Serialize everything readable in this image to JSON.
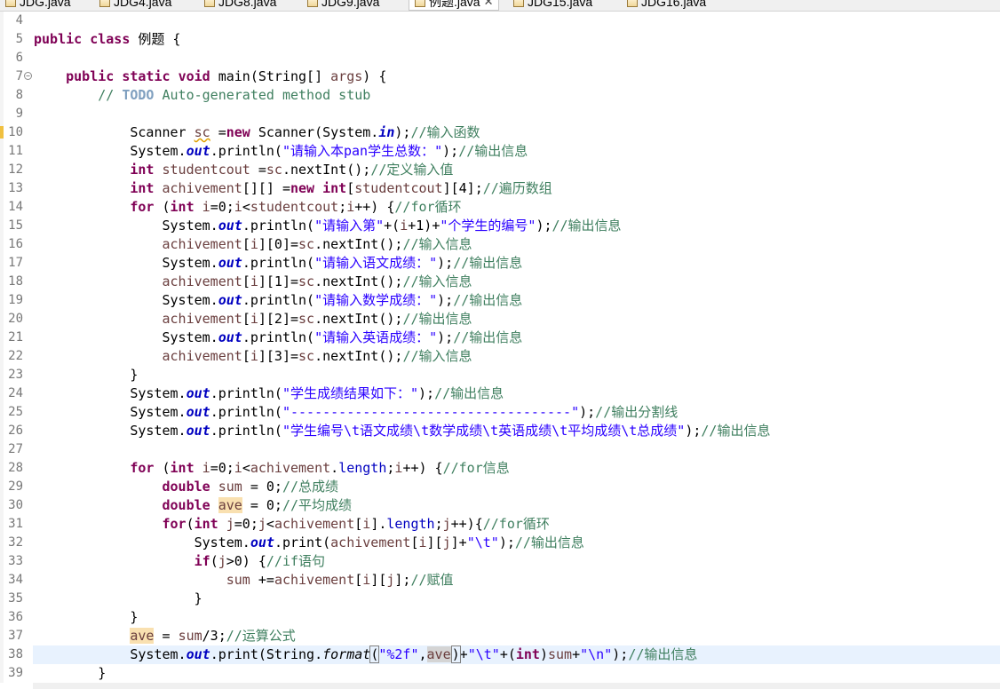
{
  "tabs": [
    {
      "label": "JDG.java",
      "active": false
    },
    {
      "label": "JDG4.java",
      "active": false
    },
    {
      "label": "JDG8.java",
      "active": false
    },
    {
      "label": "JDG9.java",
      "active": false
    },
    {
      "label": "例题.java",
      "active": true
    },
    {
      "label": "JDG15.java",
      "active": false
    },
    {
      "label": "JDG16.java",
      "active": false
    }
  ],
  "colors": {
    "keyword": "#7f0055",
    "comment": "#3f7f5f",
    "string": "#2a00ff",
    "field": "#0000c0",
    "local_var": "#6a3e3e",
    "current_line": "#e8f2fe"
  },
  "editor": {
    "current_line": 38,
    "lines": [
      {
        "n": "4",
        "text": ""
      },
      {
        "n": "5",
        "text": "public class 例题 {"
      },
      {
        "n": "6",
        "text": ""
      },
      {
        "n": "7",
        "text": "    public static void main(String[] args) {"
      },
      {
        "n": "8",
        "text": "        // TODO Auto-generated method stub"
      },
      {
        "n": "9",
        "text": ""
      },
      {
        "n": "10",
        "text": "            Scanner sc =new Scanner(System.in);//输入函数"
      },
      {
        "n": "11",
        "text": "            System.out.println(\"请输入本pan学生总数：\");//输出信息"
      },
      {
        "n": "12",
        "text": "            int studentcout =sc.nextInt();//定义输入值"
      },
      {
        "n": "13",
        "text": "            int achivement[][] =new int[studentcout][4];//遍历数组"
      },
      {
        "n": "14",
        "text": "            for (int i=0;i<studentcout;i++) {//for循环"
      },
      {
        "n": "15",
        "text": "                System.out.println(\"请输入第\"+(i+1)+\"个学生的编号\");//输出信息"
      },
      {
        "n": "16",
        "text": "                achivement[i][0]=sc.nextInt();//输入信息"
      },
      {
        "n": "17",
        "text": "                System.out.println(\"请输入语文成绩：\");//输出信息"
      },
      {
        "n": "18",
        "text": "                achivement[i][1]=sc.nextInt();//输入信息"
      },
      {
        "n": "19",
        "text": "                System.out.println(\"请输入数学成绩：\");//输出信息"
      },
      {
        "n": "20",
        "text": "                achivement[i][2]=sc.nextInt();//输出信息"
      },
      {
        "n": "21",
        "text": "                System.out.println(\"请输入英语成绩：\");//输出信息"
      },
      {
        "n": "22",
        "text": "                achivement[i][3]=sc.nextInt();//输入信息"
      },
      {
        "n": "23",
        "text": "            }"
      },
      {
        "n": "24",
        "text": "            System.out.println(\"学生成绩结果如下：\");//输出信息"
      },
      {
        "n": "25",
        "text": "            System.out.println(\"-----------------------------------\");//输出分割线"
      },
      {
        "n": "26",
        "text": "            System.out.println(\"学生编号\\t语文成绩\\t数学成绩\\t英语成绩\\t平均成绩\\t总成绩\");//输出信息"
      },
      {
        "n": "27",
        "text": ""
      },
      {
        "n": "28",
        "text": "            for (int i=0;i<achivement.length;i++) {//for信息"
      },
      {
        "n": "29",
        "text": "                double sum = 0;//总成绩"
      },
      {
        "n": "30",
        "text": "                double ave = 0;//平均成绩"
      },
      {
        "n": "31",
        "text": "                for(int j=0;j<achivement[i].length;j++){//for循环"
      },
      {
        "n": "32",
        "text": "                    System.out.print(achivement[i][j]+\"\\t\");//输出信息"
      },
      {
        "n": "33",
        "text": "                    if(j>0) {//if语句"
      },
      {
        "n": "34",
        "text": "                        sum +=achivement[i][j];//赋值"
      },
      {
        "n": "35",
        "text": "                    }"
      },
      {
        "n": "36",
        "text": "            }"
      },
      {
        "n": "37",
        "text": "            ave = sum/3;//运算公式"
      },
      {
        "n": "38",
        "text": "            System.out.print(String.format(\"%2f\",ave)+\"\\t\"+(int)sum+\"\\n\");//输出信息"
      },
      {
        "n": "39",
        "text": "        }"
      }
    ]
  }
}
